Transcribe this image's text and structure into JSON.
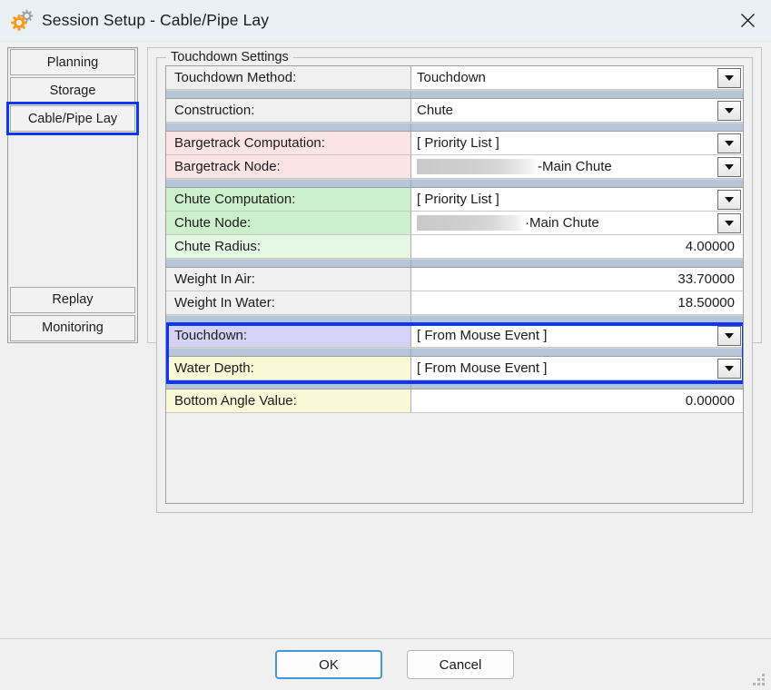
{
  "window": {
    "title": "Session Setup - Cable/Pipe Lay",
    "icon": "gears-icon",
    "close_label": "✕"
  },
  "sidebar": {
    "top_items": [
      {
        "label": "Planning",
        "selected": false
      },
      {
        "label": "Storage",
        "selected": false
      },
      {
        "label": "Cable/Pipe Lay",
        "selected": true
      }
    ],
    "bottom_items": [
      {
        "label": "Replay",
        "selected": false
      },
      {
        "label": "Monitoring",
        "selected": false
      }
    ]
  },
  "group": {
    "legend": "Touchdown Settings"
  },
  "rows": [
    {
      "label": "Touchdown Method:",
      "value": "Touchdown",
      "tint": "plain",
      "kind": "combo"
    },
    {
      "label": "Construction:",
      "value": "Chute",
      "tint": "plain",
      "kind": "combo"
    },
    {
      "label": "Bargetrack Computation:",
      "value": "[ Priority List ]",
      "tint": "pink",
      "kind": "combo"
    },
    {
      "label": "Bargetrack Node:",
      "value": "-Main Chute",
      "tint": "pink",
      "kind": "combo",
      "redacted": true,
      "redact_width": 133
    },
    {
      "label": "Chute Computation:",
      "value": "[ Priority List ]",
      "tint": "green",
      "kind": "combo"
    },
    {
      "label": "Chute Node:",
      "value": "·Main Chute",
      "tint": "green",
      "kind": "combo",
      "redacted": true,
      "redact_width": 119
    },
    {
      "label": "Chute Radius:",
      "value": "4.00000",
      "tint": "green2",
      "kind": "number"
    },
    {
      "label": "Weight In Air:",
      "value": "33.70000",
      "tint": "plain",
      "kind": "number"
    },
    {
      "label": "Weight In Water:",
      "value": "18.50000",
      "tint": "plain",
      "kind": "number"
    },
    {
      "label": "Touchdown:",
      "value": "[ From Mouse Event ]",
      "tint": "lav",
      "kind": "combo"
    },
    {
      "label": "Water Depth:",
      "value": "[ From Mouse Event ]",
      "tint": "yel",
      "kind": "combo"
    },
    {
      "label": "Bottom Angle Value:",
      "value": "0.00000",
      "tint": "yel",
      "kind": "number"
    }
  ],
  "separators_after": [
    0,
    1,
    3,
    6,
    8,
    9,
    10
  ],
  "highlight": {
    "color": "#0b37f2",
    "rows": [
      "Touchdown:",
      "Water Depth:"
    ]
  },
  "footer": {
    "ok_label": "OK",
    "cancel_label": "Cancel"
  }
}
